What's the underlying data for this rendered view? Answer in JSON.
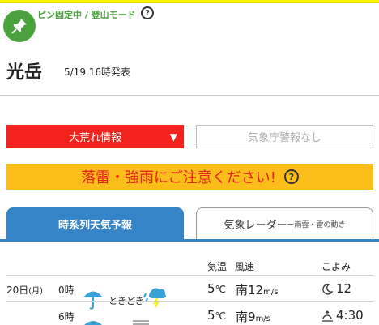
{
  "pin": {
    "text": "ピン固定中 / 登山モード",
    "help": "?"
  },
  "mountain": {
    "name": "光岳",
    "issued": "5/19 16時発表"
  },
  "buttons": {
    "storm": "大荒れ情報",
    "storm_arrow": "▼",
    "jma": "気象庁警報なし"
  },
  "alert": {
    "text": "落雷・強雨にご注意ください!",
    "help": "?"
  },
  "tabs": {
    "forecast": "時系列天気予報",
    "radar": "気象レーダー",
    "radar_sub": "ー雨雲・雷の動き"
  },
  "table": {
    "headers": {
      "temp": "気温",
      "wind": "風速",
      "almanac": "こよみ"
    },
    "day": "20日",
    "weekday": "(月)",
    "rows": [
      {
        "hour": "0時",
        "weather": "ときどき",
        "temp": "5",
        "temp_unit": "℃",
        "wind_dir": "南",
        "wind_speed": "12",
        "wind_unit": "m/s",
        "almanac_icon": "moon-icon",
        "almanac": "12"
      },
      {
        "hour": "6時",
        "weather": "",
        "temp": "5",
        "temp_unit": "℃",
        "wind_dir": "南",
        "wind_speed": "9",
        "wind_unit": "m/s",
        "almanac_icon": "sunrise-icon",
        "almanac": "4:30"
      }
    ]
  },
  "colors": {
    "accent_blue": "#3484c7",
    "storm_red": "#f2231d",
    "alert_yellow": "#fbbd1a",
    "pin_green": "#4aa23c"
  }
}
